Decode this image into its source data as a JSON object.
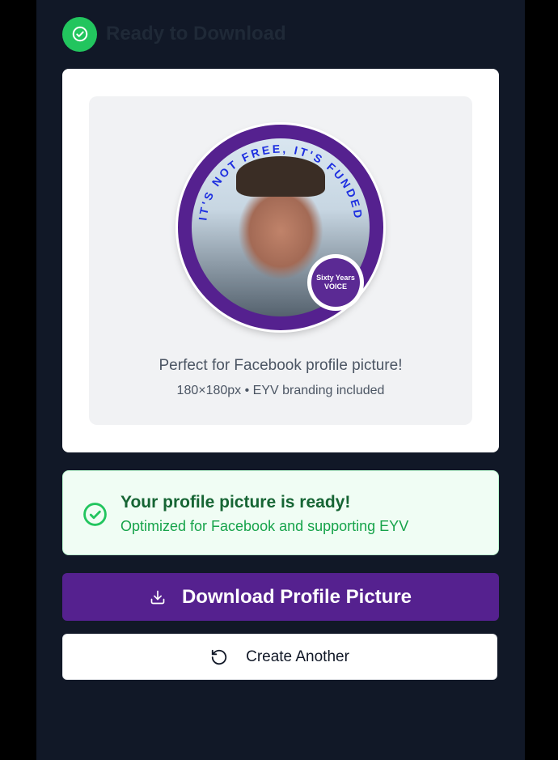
{
  "header": {
    "title": "Ready to Download",
    "icon": "check-circle-icon",
    "icon_color": "#22c55e"
  },
  "preview": {
    "ring_text": "IT'S NOT FREE, IT'S FUNDED",
    "badge_line1": "Sixty Years",
    "badge_line2": "VOICE",
    "caption": "Perfect for Facebook profile picture!",
    "meta": "180×180px • EYV branding included"
  },
  "success": {
    "title": "Your profile picture is ready!",
    "subtitle": "Optimized for Facebook and supporting EYV",
    "icon": "check-circle-icon"
  },
  "actions": {
    "download_label": "Download Profile Picture",
    "create_label": "Create Another"
  },
  "colors": {
    "brand_purple": "#55218f",
    "success_green": "#22c55e",
    "background": "#111827"
  }
}
